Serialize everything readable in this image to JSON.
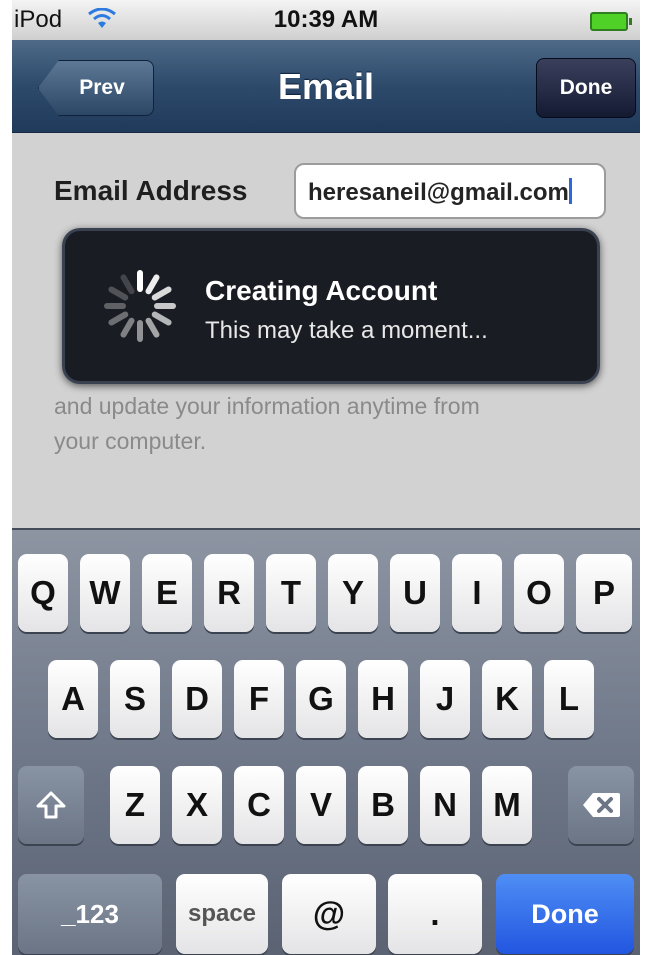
{
  "status_bar": {
    "carrier": "iPod",
    "time": "10:39 AM",
    "wifi_icon": "wifi-icon",
    "battery_icon": "battery-icon"
  },
  "nav": {
    "prev_label": "Prev",
    "title": "Email",
    "done_label": "Done"
  },
  "form": {
    "email_label": "Email Address",
    "email_value": "heresaneil@gmail.com"
  },
  "info_text": {
    "line_1": "and update your information anytime from",
    "line_2": "your computer."
  },
  "hud": {
    "title": "Creating Account",
    "subtitle": "This may take a moment...",
    "spinner_icon": "spinner-icon"
  },
  "keyboard": {
    "row1": [
      "Q",
      "W",
      "E",
      "R",
      "T",
      "Y",
      "U",
      "I",
      "O",
      "P"
    ],
    "row2": [
      "A",
      "S",
      "D",
      "F",
      "G",
      "H",
      "J",
      "K",
      "L"
    ],
    "row3": [
      "Z",
      "X",
      "C",
      "V",
      "B",
      "N",
      "M"
    ],
    "shift_icon": "shift-arrow-icon",
    "backspace_icon": "backspace-icon",
    "numbers_label": "_123",
    "space_label": "space",
    "at_label": "@",
    "dot_label": ".",
    "done_label": "Done",
    "done_color": "#2c62e6"
  }
}
